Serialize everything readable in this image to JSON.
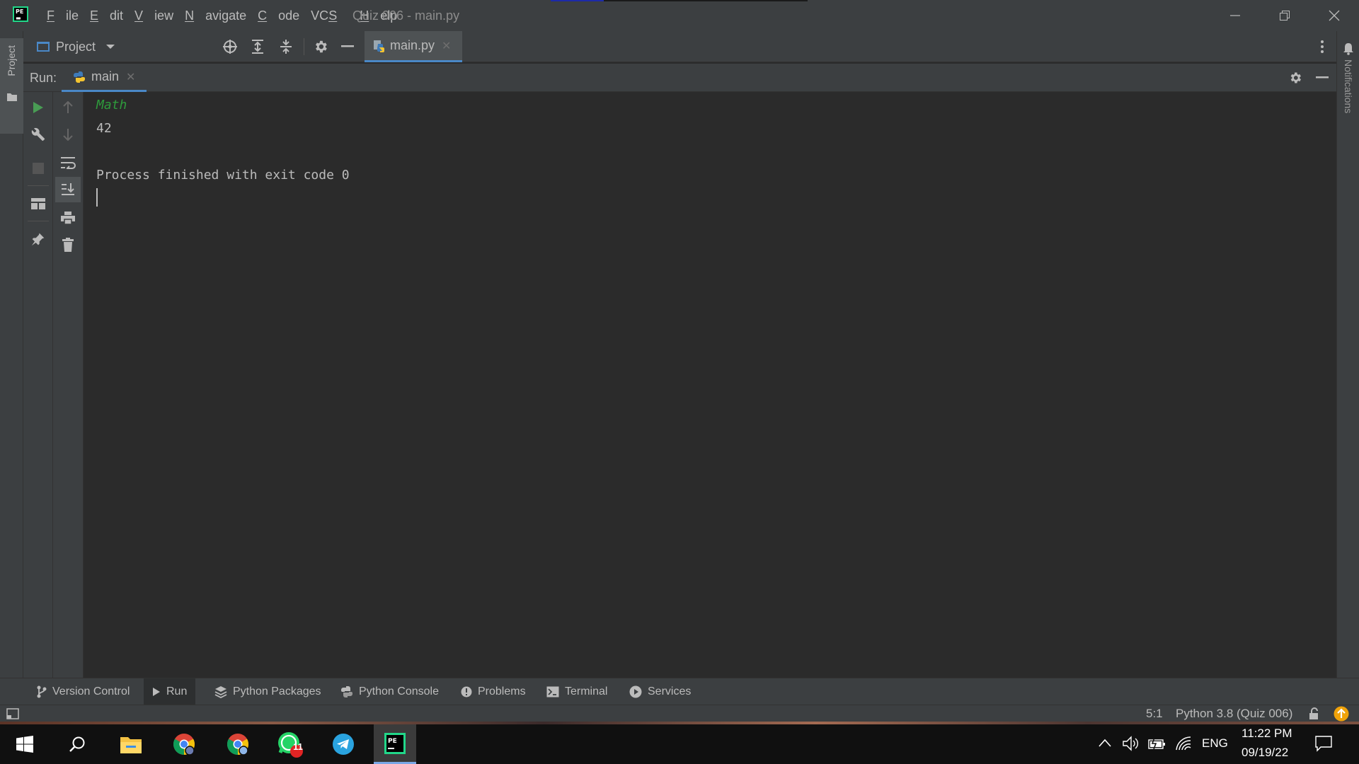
{
  "window": {
    "title": "Quiz 006 - main.py",
    "menu": [
      "File",
      "Edit",
      "View",
      "Navigate",
      "Code",
      "VCS",
      "Help"
    ]
  },
  "sidebar": {
    "project_stripe_label": "Project",
    "notifications_label": "Notifications"
  },
  "toolbar": {
    "project_label": "Project",
    "editor_tab": "main.py"
  },
  "run_panel": {
    "label": "Run:",
    "tab": "main"
  },
  "console": {
    "lines": [
      "Math",
      "42",
      "",
      "Process finished with exit code 0"
    ]
  },
  "tool_windows": [
    "Version Control",
    "Run",
    "Python Packages",
    "Python Console",
    "Problems",
    "Terminal",
    "Services"
  ],
  "status": {
    "position": "5:1",
    "interpreter": "Python 3.8 (Quiz 006)"
  },
  "taskbar": {
    "whatsapp_badge": "11",
    "language": "ENG",
    "time": "11:22 PM",
    "date": "09/19/22"
  },
  "colors": {
    "accent": "#4a88c7",
    "console_italic": "#2e9b3c",
    "pycharm_green": "#21d789"
  },
  "icons": [
    "pycharm-logo-icon",
    "crosshair-icon",
    "expand-all-icon",
    "collapse-all-icon",
    "gear-icon",
    "minimize-icon",
    "python-file-icon",
    "close-icon",
    "play-icon",
    "wrench-icon",
    "stop-icon",
    "layout-icon",
    "pin-icon",
    "arrow-up-icon",
    "arrow-down-icon",
    "soft-wrap-icon",
    "scroll-to-end-icon",
    "print-icon",
    "trash-icon",
    "bell-icon",
    "windows-start-icon",
    "search-icon",
    "file-explorer-icon",
    "chrome-icon",
    "whatsapp-icon",
    "telegram-icon",
    "notifications-center-icon"
  ]
}
